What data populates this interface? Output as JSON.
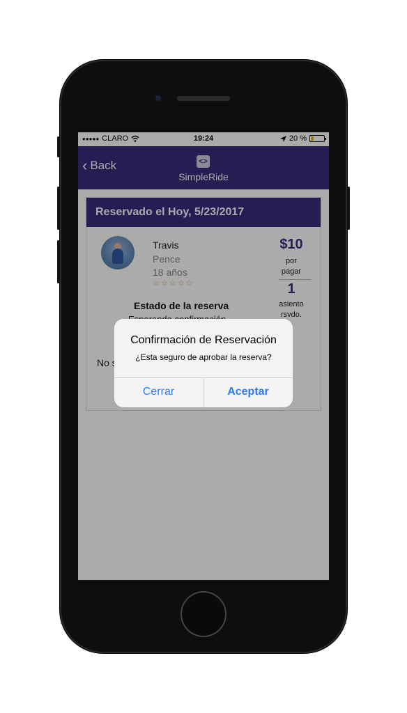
{
  "status_bar": {
    "signal": "●●●●●",
    "carrier": "CLARO",
    "wifi_icon": "wifi-icon",
    "time": "19:24",
    "location_icon": "location-arrow-icon",
    "battery_text": "20 %",
    "battery_level": 0.2
  },
  "nav": {
    "back_label": "Back",
    "logo_text": "SimpleRide",
    "logo_icon_glyph": "<>",
    "bar_color": "#3b2a7c"
  },
  "reservation": {
    "header": "Reservado el Hoy, 5/23/2017",
    "first_name": "Travis",
    "last_name": "Pence",
    "age": "18 años",
    "stars": "☆☆☆☆☆",
    "price": "$10",
    "price_label_1": "por",
    "price_label_2": "pagar",
    "seats": "1",
    "seats_label_1": "asiento",
    "seats_label_2": "rsvdo.",
    "status_title": "Estado de la reserva",
    "status_value": "Esperando confirmación",
    "footer_partial": "No s"
  },
  "alert": {
    "title": "Confirmación de Reservación",
    "message": "¿Esta seguro de aprobar la reserva?",
    "cancel_label": "Cerrar",
    "confirm_label": "Aceptar",
    "button_color": "#2f7bf0"
  }
}
